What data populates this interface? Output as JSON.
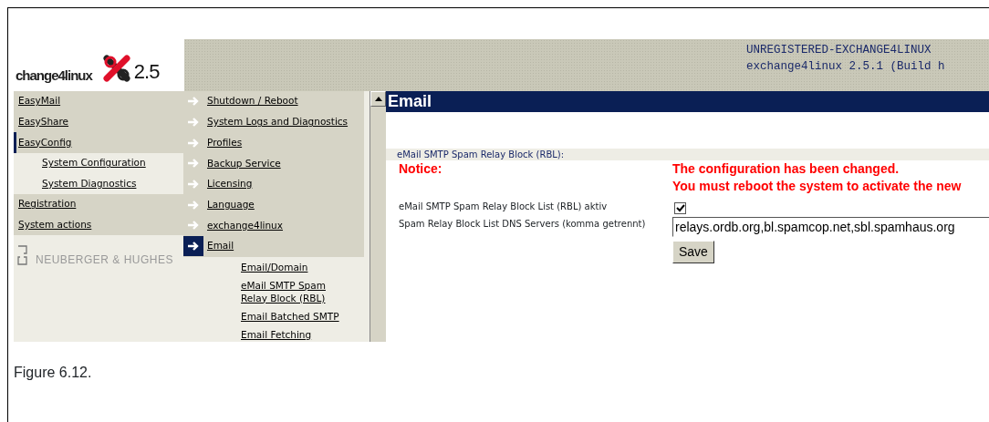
{
  "header": {
    "logo_text": "change4linux",
    "logo_version": "2.5",
    "lines": [
      "UNREGISTERED-EXCHANGE4LINUX",
      "exchange4linux 2.5.1 (Build h"
    ]
  },
  "main_menu": [
    {
      "label": "EasyMail",
      "selected": false
    },
    {
      "label": "EasyShare",
      "selected": false
    },
    {
      "label": "EasyConfig",
      "selected": true,
      "children": [
        {
          "label": "System Configuration"
        },
        {
          "label": "System Diagnostics"
        }
      ]
    },
    {
      "label": "Registration",
      "selected": false
    },
    {
      "label": "System actions",
      "selected": false
    }
  ],
  "partner_logo": "NEUBERGER & HUGHES",
  "config_menu": [
    {
      "label": "Shutdown / Reboot",
      "selected": false
    },
    {
      "label": "System Logs and Diagnostics",
      "selected": false
    },
    {
      "label": "Profiles",
      "selected": false
    },
    {
      "label": "Backup Service",
      "selected": false
    },
    {
      "label": "Licensing",
      "selected": false
    },
    {
      "label": "Language",
      "selected": false
    },
    {
      "label": "exchange4linux",
      "selected": false
    },
    {
      "label": "Email",
      "selected": true,
      "children": [
        {
          "label": "Email/Domain"
        },
        {
          "label": "eMail SMTP Spam Relay Block (RBL)"
        },
        {
          "label": "Email Batched SMTP"
        },
        {
          "label": "Email Fetching"
        }
      ]
    }
  ],
  "content": {
    "title": "Email",
    "section": "eMail SMTP Spam Relay Block (RBL):",
    "notice_label": "Notice:",
    "notice_lines": [
      "The configuration has been changed.",
      "You must reboot the system to activate the new"
    ],
    "fields": [
      {
        "kind": "checkbox",
        "label": "eMail SMTP Spam Relay Block List (RBL) aktiv",
        "checked": true
      },
      {
        "kind": "text",
        "label": "Spam Relay Block List DNS Servers (komma getrennt)",
        "value": "relays.ordb.org,bl.spamcop.net,sbl.spamhaus.org"
      }
    ],
    "buttons": [
      "Save"
    ]
  },
  "caption": "Figure 6.12."
}
